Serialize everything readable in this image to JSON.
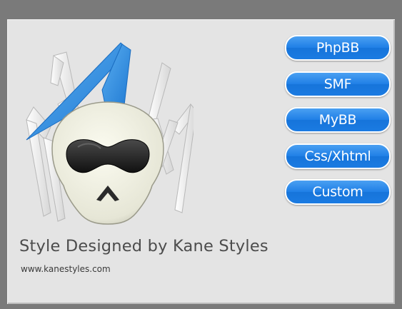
{
  "menu": {
    "items": [
      {
        "label": "PhpBB"
      },
      {
        "label": "SMF"
      },
      {
        "label": "MyBB"
      },
      {
        "label": "Css/Xhtml"
      },
      {
        "label": "Custom"
      }
    ]
  },
  "footer": {
    "title": "Style Designed by Kane Styles",
    "url": "www.kanestyles.com"
  },
  "colors": {
    "background": "#7a7a7a",
    "panel": "#e4e4e4",
    "button": "#1f7fe6",
    "accent_blue": "#3c8fd8",
    "text": "#4c4c4c"
  },
  "icons": {
    "logo": "spider-skull-mascot-icon"
  }
}
